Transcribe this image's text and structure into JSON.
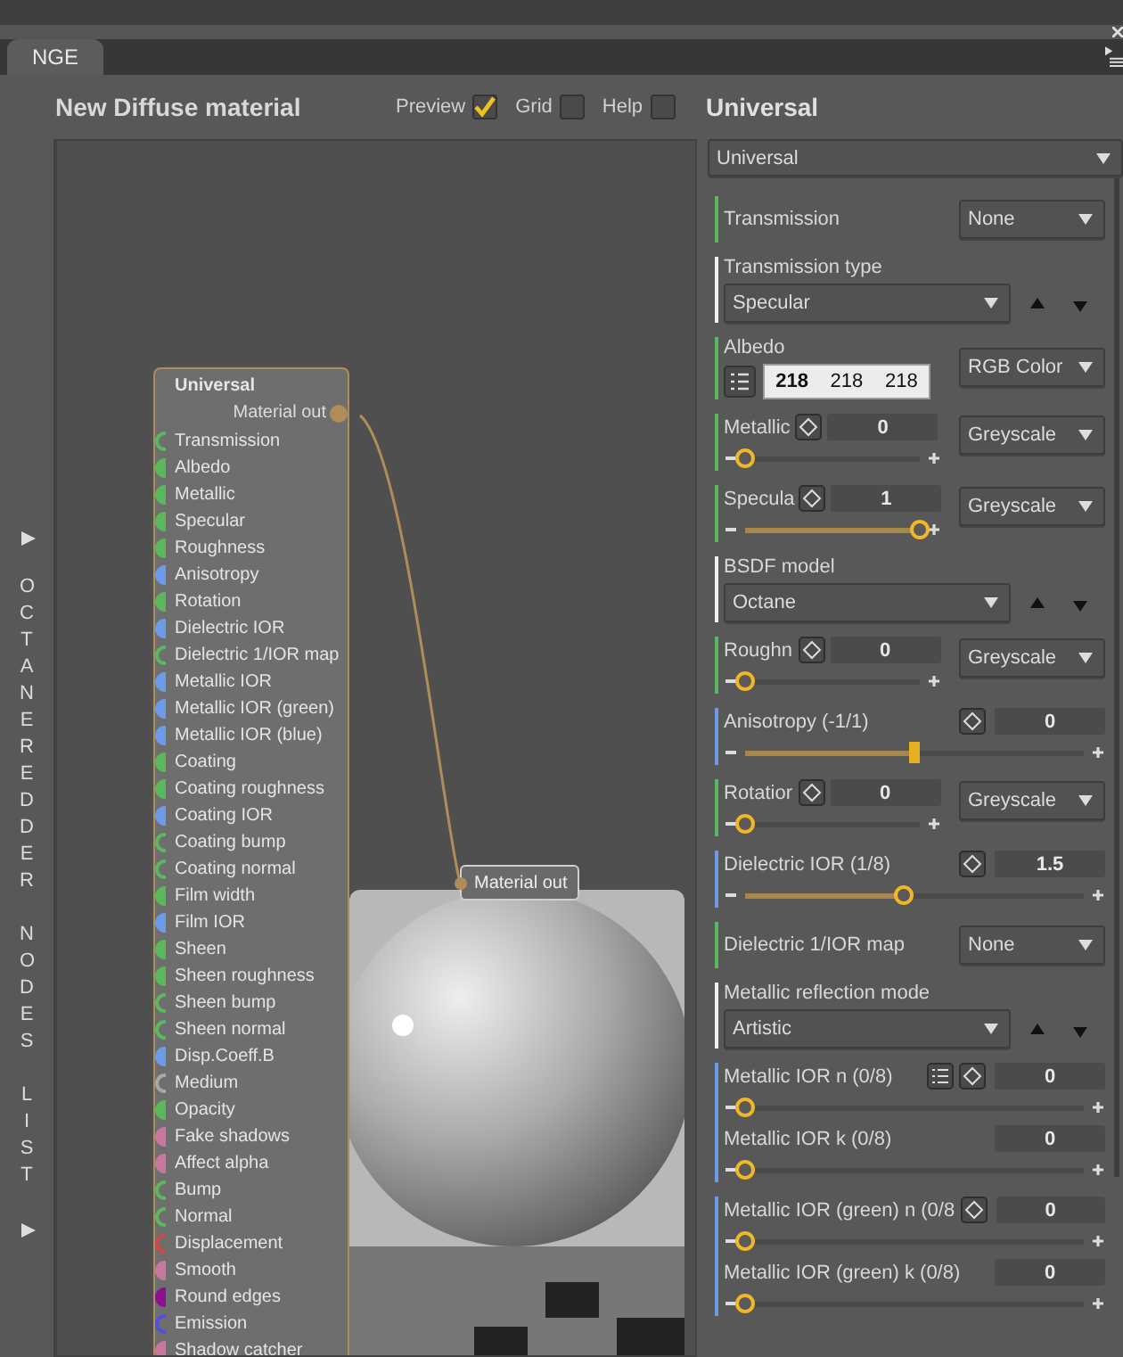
{
  "app_tab": {
    "label": "NGE",
    "selected": true
  },
  "header": {
    "title": "New Diffuse material",
    "toggles": [
      {
        "label": "Preview",
        "checked": true
      },
      {
        "label": "Grid",
        "checked": false
      },
      {
        "label": "Help",
        "checked": false
      }
    ],
    "node_type": "Universal"
  },
  "sidebar": {
    "labels": [
      "OCTANEREDDER",
      "NODES",
      "LIST"
    ]
  },
  "node": {
    "title": "Universal",
    "output": "Material out",
    "inputs": [
      {
        "label": "Transmission",
        "color": "#5cb85c",
        "filled": false
      },
      {
        "label": "Albedo",
        "color": "#5cb85c",
        "filled": true
      },
      {
        "label": "Metallic",
        "color": "#5cb85c",
        "filled": true
      },
      {
        "label": "Specular",
        "color": "#5cb85c",
        "filled": true
      },
      {
        "label": "Roughness",
        "color": "#5cb85c",
        "filled": true
      },
      {
        "label": "Anisotropy",
        "color": "#6c9ce8",
        "filled": true
      },
      {
        "label": "Rotation",
        "color": "#5cb85c",
        "filled": true
      },
      {
        "label": "Dielectric IOR",
        "color": "#6c9ce8",
        "filled": true
      },
      {
        "label": "Dielectric 1/IOR map",
        "color": "#5cb85c",
        "filled": false
      },
      {
        "label": "Metallic IOR",
        "color": "#6c9ce8",
        "filled": true
      },
      {
        "label": "Metallic IOR (green)",
        "color": "#6c9ce8",
        "filled": true
      },
      {
        "label": "Metallic IOR (blue)",
        "color": "#6c9ce8",
        "filled": true
      },
      {
        "label": "Coating",
        "color": "#5cb85c",
        "filled": true
      },
      {
        "label": "Coating roughness",
        "color": "#5cb85c",
        "filled": true
      },
      {
        "label": "Coating IOR",
        "color": "#6c9ce8",
        "filled": true
      },
      {
        "label": "Coating bump",
        "color": "#5cb85c",
        "filled": false
      },
      {
        "label": "Coating normal",
        "color": "#5cb85c",
        "filled": false
      },
      {
        "label": "Film width",
        "color": "#5cb85c",
        "filled": true
      },
      {
        "label": "Film IOR",
        "color": "#6c9ce8",
        "filled": true
      },
      {
        "label": "Sheen",
        "color": "#5cb85c",
        "filled": true
      },
      {
        "label": "Sheen roughness",
        "color": "#5cb85c",
        "filled": true
      },
      {
        "label": "Sheen bump",
        "color": "#5cb85c",
        "filled": false
      },
      {
        "label": "Sheen normal",
        "color": "#5cb85c",
        "filled": false
      },
      {
        "label": "Disp.Coeff.B",
        "color": "#6c9ce8",
        "filled": true
      },
      {
        "label": "Medium",
        "color": "#a8a8a8",
        "filled": false
      },
      {
        "label": "Opacity",
        "color": "#5cb85c",
        "filled": true
      },
      {
        "label": "Fake shadows",
        "color": "#c878a0",
        "filled": true
      },
      {
        "label": "Affect alpha",
        "color": "#c878a0",
        "filled": true
      },
      {
        "label": "Bump",
        "color": "#5cb85c",
        "filled": false
      },
      {
        "label": "Normal",
        "color": "#5cb85c",
        "filled": false
      },
      {
        "label": "Displacement",
        "color": "#d04848",
        "filled": false
      },
      {
        "label": "Smooth",
        "color": "#c878a0",
        "filled": true
      },
      {
        "label": "Round edges",
        "color": "#8a1090",
        "filled": true
      },
      {
        "label": "Emission",
        "color": "#5050e0",
        "filled": false
      },
      {
        "label": "Shadow catcher",
        "color": "#c878a0",
        "filled": true
      }
    ]
  },
  "output_node": {
    "label": "Material out"
  },
  "panel": {
    "type_select": "Universal",
    "groups": [
      {
        "color": "#5cb85c",
        "rows": [
          {
            "kind": "select",
            "label": "Transmission",
            "option": "None"
          }
        ]
      },
      {
        "color": "#f0f0f0",
        "rows": [
          {
            "kind": "enum",
            "label": "Transmission type",
            "option": "Specular"
          }
        ]
      },
      {
        "color": "#5cb85c",
        "rows": [
          {
            "kind": "color",
            "label": "Albedo",
            "values": [
              "218",
              "218",
              "218"
            ],
            "mode": "RGB Color"
          }
        ]
      },
      {
        "color": "#5cb85c",
        "rows": [
          {
            "kind": "texture",
            "label": "Metallic",
            "value": "0",
            "level": 0,
            "mode": "Greyscale"
          }
        ]
      },
      {
        "color": "#5cb85c",
        "rows": [
          {
            "kind": "texture",
            "label": "Specula",
            "value": "1",
            "level": 1,
            "mode": "Greyscale"
          }
        ]
      },
      {
        "color": "#f0f0f0",
        "rows": [
          {
            "kind": "enum",
            "label": "BSDF model",
            "option": "Octane"
          }
        ]
      },
      {
        "color": "#5cb85c",
        "rows": [
          {
            "kind": "texture",
            "label": "Roughn",
            "value": "0",
            "level": 0,
            "mode": "Greyscale"
          }
        ]
      },
      {
        "color": "#6c9ce8",
        "rows": [
          {
            "kind": "slider",
            "label": "Anisotropy (-1/1)",
            "value": "0",
            "level": 0.5,
            "bipolar": true,
            "list_button": false,
            "key_button": true
          }
        ]
      },
      {
        "color": "#5cb85c",
        "rows": [
          {
            "kind": "texture",
            "label": "Rotatior",
            "value": "0",
            "level": 0,
            "mode": "Greyscale"
          }
        ]
      },
      {
        "color": "#6c9ce8",
        "rows": [
          {
            "kind": "slider",
            "label": "Dielectric IOR (1/8)",
            "value": "1.5",
            "level": 0.47,
            "bipolar": false,
            "list_button": false,
            "key_button": true
          }
        ]
      },
      {
        "color": "#5cb85c",
        "rows": [
          {
            "kind": "select",
            "label": "Dielectric 1/IOR map",
            "option": "None"
          }
        ]
      },
      {
        "color": "#f0f0f0",
        "rows": [
          {
            "kind": "enum",
            "label": "Metallic reflection mode",
            "option": "Artistic"
          }
        ]
      },
      {
        "color": "#6c9ce8",
        "rows": [
          {
            "kind": "slider",
            "label": "Metallic IOR n (0/8)",
            "value": "0",
            "level": 0,
            "bipolar": false,
            "list_button": true,
            "key_button": true
          },
          {
            "kind": "slider",
            "label": "Metallic IOR k (0/8)",
            "value": "0",
            "level": 0,
            "bipolar": false,
            "list_button": false,
            "key_button": false
          }
        ]
      },
      {
        "color": "#6c9ce8",
        "rows": [
          {
            "kind": "slider",
            "label": "Metallic IOR (green) n (0/8",
            "value": "0",
            "level": 0,
            "bipolar": false,
            "list_button": false,
            "key_button": true
          },
          {
            "kind": "slider",
            "label": "Metallic IOR (green) k (0/8)",
            "value": "0",
            "level": 0,
            "bipolar": false,
            "list_button": false,
            "key_button": false
          }
        ]
      }
    ]
  }
}
